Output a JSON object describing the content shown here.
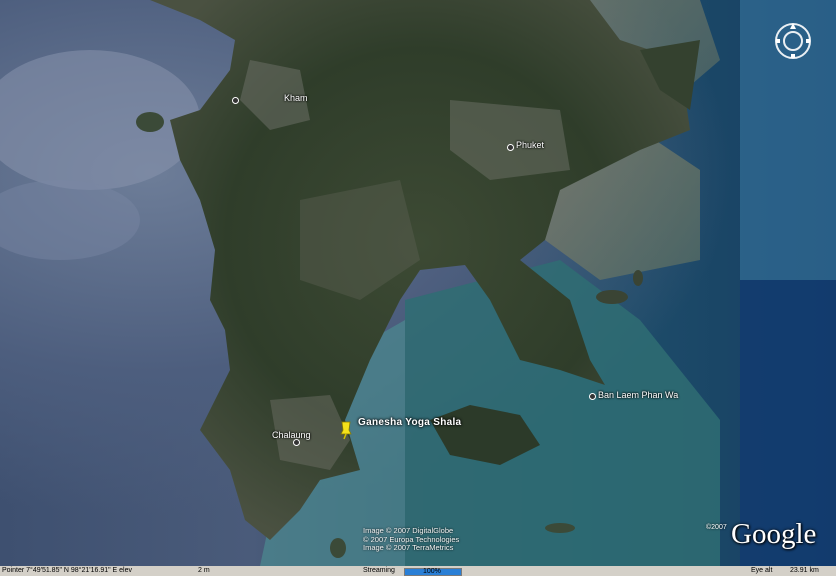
{
  "places": [
    {
      "name": "Kham"
    },
    {
      "name": "Phuket"
    },
    {
      "name": "Ban Laem Phan Wa"
    },
    {
      "name": "Chalaung"
    }
  ],
  "poi": {
    "name": "Ganesha Yoga Shala",
    "icon": "yellow-pushpin-icon",
    "color": "#f5e21b"
  },
  "attribution": {
    "line1": "Image © 2007 DigitalGlobe",
    "line2": "© 2007 Europa Technologies",
    "line3": "Image © 2007 TerraMetrics"
  },
  "logo": {
    "text": "Google",
    "year": "©2007"
  },
  "compass": {
    "icon": "compass-icon"
  },
  "status_bar": {
    "pointer": "Pointer  7°49'51.85\" N   98°21'16.91\" E elev",
    "elev": "2 m",
    "streaming_label": "Streaming",
    "streaming_percent": "100%",
    "streaming_fraction": 1.0,
    "eye_alt_label": "Eye alt",
    "eye_alt_value": "23.91 km"
  }
}
